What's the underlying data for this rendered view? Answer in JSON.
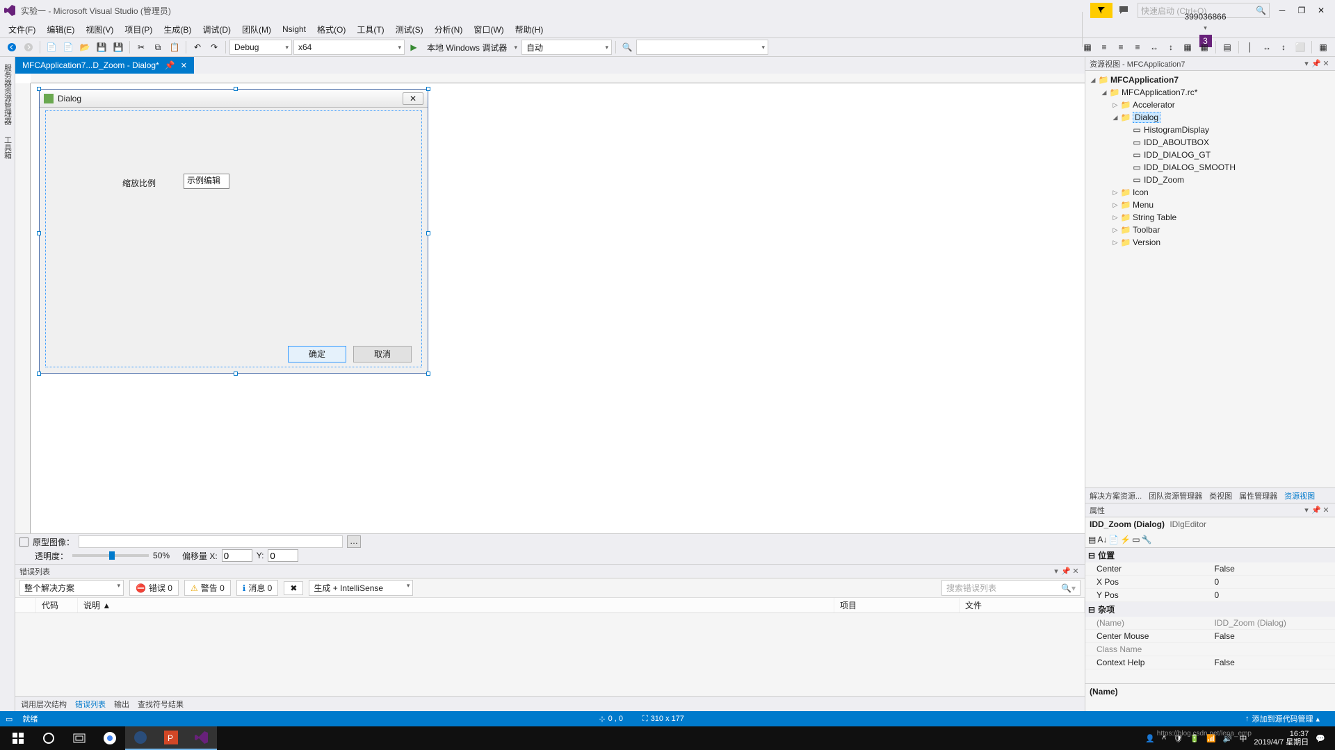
{
  "titlebar": {
    "title": "实验一 - Microsoft Visual Studio (管理员)",
    "quick_placeholder": "快速启动 (Ctrl+Q)",
    "notif_count": "3"
  },
  "menubar": {
    "items": [
      "文件(F)",
      "编辑(E)",
      "视图(V)",
      "项目(P)",
      "生成(B)",
      "调试(D)",
      "团队(M)",
      "Nsight",
      "格式(O)",
      "工具(T)",
      "测试(S)",
      "分析(N)",
      "窗口(W)",
      "帮助(H)"
    ],
    "account": "399036866"
  },
  "toolbar": {
    "config": "Debug",
    "platform": "x64",
    "run_label": "本地 Windows 调试器",
    "run_mode": "自动"
  },
  "left_tabs": [
    "服务器资源管理器",
    "工具箱"
  ],
  "doc_tab": {
    "title": "MFCApplication7...D_Zoom - Dialog*"
  },
  "dialog": {
    "caption": "Dialog",
    "label": "缩放比例",
    "edit_text": "示例编辑",
    "ok": "确定",
    "cancel": "取消"
  },
  "designer_footer": {
    "proto_label": "原型图像：",
    "opacity_label": "透明度：",
    "opacity_pct": "50%",
    "offset_x_label": "偏移量 X:",
    "offset_x": "0",
    "offset_y_label": "Y:",
    "offset_y": "0"
  },
  "errorlist": {
    "title": "错误列表",
    "scope": "整个解决方案",
    "errors": "错误 0",
    "warnings": "警告 0",
    "messages": "消息 0",
    "build_filter": "生成 + IntelliSense",
    "search_placeholder": "搜索错误列表",
    "cols": [
      "",
      "代码",
      "说明 ▲",
      "",
      "项目",
      "文件"
    ]
  },
  "bottom_tabs": [
    "调用层次结构",
    "错误列表",
    "输出",
    "查找符号结果"
  ],
  "resview": {
    "title": "资源视图 - MFCApplication7",
    "root": "MFCApplication7",
    "rc": "MFCApplication7.rc*",
    "folders": {
      "accelerator": "Accelerator",
      "dialog": "Dialog",
      "icon": "Icon",
      "menu": "Menu",
      "string": "String Table",
      "toolbar": "Toolbar",
      "version": "Version"
    },
    "dialogs": [
      "HistogramDisplay",
      "IDD_ABOUTBOX",
      "IDD_DIALOG_GT",
      "IDD_DIALOG_SMOOTH",
      "IDD_Zoom"
    ]
  },
  "right_tabs": [
    "解决方案资源...",
    "团队资源管理器",
    "类视图",
    "属性管理器",
    "资源视图"
  ],
  "props": {
    "title": "属性",
    "selected": "IDD_Zoom (Dialog)",
    "editor": "IDlgEditor",
    "cat_pos": "位置",
    "cat_misc": "杂项",
    "rows": [
      {
        "k": "Center",
        "v": "False"
      },
      {
        "k": "X Pos",
        "v": "0"
      },
      {
        "k": "Y Pos",
        "v": "0"
      }
    ],
    "rows2": [
      {
        "k": "(Name)",
        "v": "IDD_Zoom (Dialog)"
      },
      {
        "k": "Center Mouse",
        "v": "False"
      },
      {
        "k": "Class Name",
        "v": ""
      },
      {
        "k": "Context Help",
        "v": "False"
      }
    ],
    "desc": "(Name)"
  },
  "statusbar": {
    "ready": "就绪",
    "pos": "0 , 0",
    "size": "310 x 177",
    "add": "添加到源代码管理"
  },
  "taskbar": {
    "time": "16:37",
    "date": "2019/4/7 星期日",
    "watermark": "https://blog.csdn.net/lena_emp"
  }
}
